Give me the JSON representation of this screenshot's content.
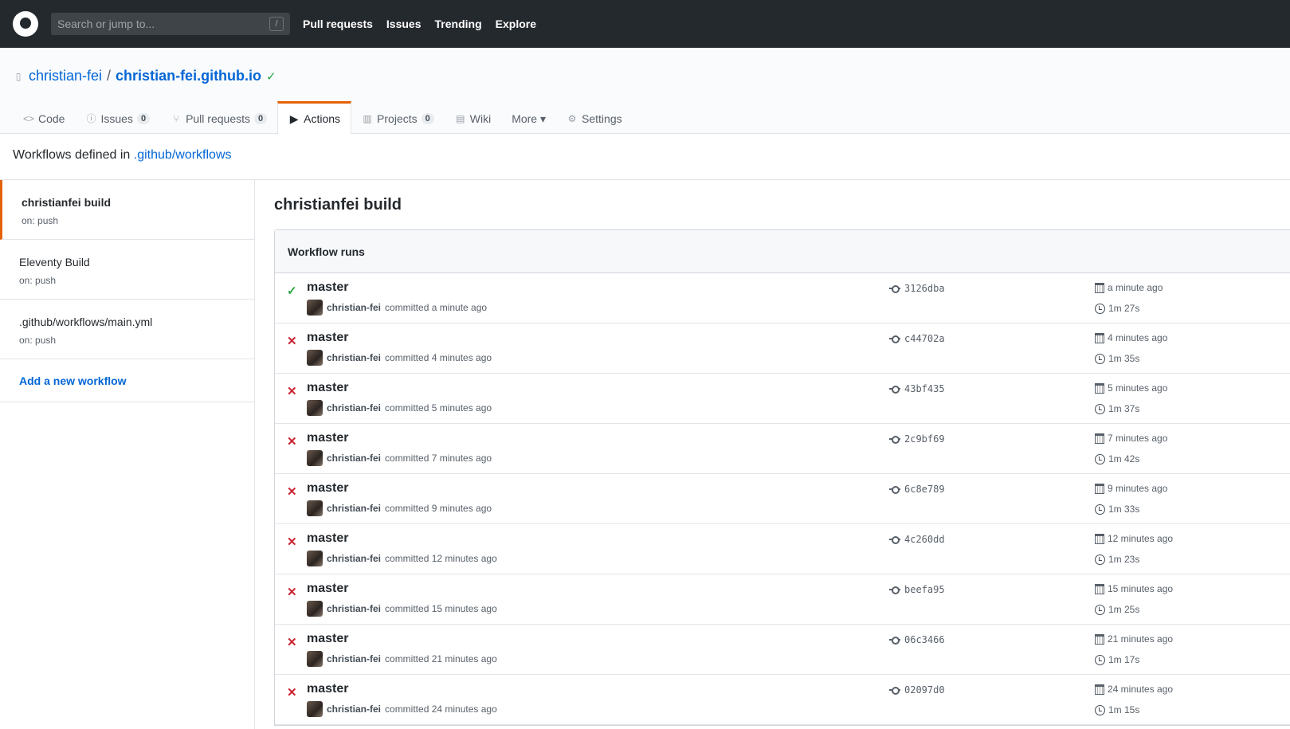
{
  "header": {
    "search_placeholder": "Search or jump to...",
    "search_shortcut": "/",
    "nav": [
      "Pull requests",
      "Issues",
      "Trending",
      "Explore"
    ]
  },
  "repo": {
    "owner": "christian-fei",
    "separator": "/",
    "name": "christian-fei.github.io",
    "status": "✓"
  },
  "tabs": [
    {
      "label": "Code",
      "icon": "code-icon"
    },
    {
      "label": "Issues",
      "count": "0",
      "icon": "issue-icon"
    },
    {
      "label": "Pull requests",
      "count": "0",
      "icon": "pull-request-icon"
    },
    {
      "label": "Actions",
      "icon": "play-icon"
    },
    {
      "label": "Projects",
      "count": "0",
      "icon": "project-icon"
    },
    {
      "label": "Wiki",
      "icon": "book-icon"
    },
    {
      "label": "More ▾"
    },
    {
      "label": "Settings",
      "icon": "gear-icon"
    }
  ],
  "workflows_line": {
    "prefix": "Workflows defined in",
    "link": ".github/workflows"
  },
  "sidebar": {
    "items": [
      {
        "title": "christianfei build",
        "trigger": "on: push"
      },
      {
        "title": "Eleventy Build",
        "trigger": "on: push"
      },
      {
        "title": ".github/workflows/main.yml",
        "trigger": "on: push"
      }
    ],
    "add_label": "Add a new workflow"
  },
  "main": {
    "title": "christianfei build",
    "box_title": "Workflow runs",
    "runs": [
      {
        "status": "success",
        "branch": "master",
        "user": "christian-fei",
        "committed": "committed a minute ago",
        "sha": "3126dba",
        "date": "a minute ago",
        "duration": "1m 27s"
      },
      {
        "status": "failure",
        "branch": "master",
        "user": "christian-fei",
        "committed": "committed 4 minutes ago",
        "sha": "c44702a",
        "date": "4 minutes ago",
        "duration": "1m 35s"
      },
      {
        "status": "failure",
        "branch": "master",
        "user": "christian-fei",
        "committed": "committed 5 minutes ago",
        "sha": "43bf435",
        "date": "5 minutes ago",
        "duration": "1m 37s"
      },
      {
        "status": "failure",
        "branch": "master",
        "user": "christian-fei",
        "committed": "committed 7 minutes ago",
        "sha": "2c9bf69",
        "date": "7 minutes ago",
        "duration": "1m 42s"
      },
      {
        "status": "failure",
        "branch": "master",
        "user": "christian-fei",
        "committed": "committed 9 minutes ago",
        "sha": "6c8e789",
        "date": "9 minutes ago",
        "duration": "1m 33s"
      },
      {
        "status": "failure",
        "branch": "master",
        "user": "christian-fei",
        "committed": "committed 12 minutes ago",
        "sha": "4c260dd",
        "date": "12 minutes ago",
        "duration": "1m 23s"
      },
      {
        "status": "failure",
        "branch": "master",
        "user": "christian-fei",
        "committed": "committed 15 minutes ago",
        "sha": "beefa95",
        "date": "15 minutes ago",
        "duration": "1m 25s"
      },
      {
        "status": "failure",
        "branch": "master",
        "user": "christian-fei",
        "committed": "committed 21 minutes ago",
        "sha": "06c3466",
        "date": "21 minutes ago",
        "duration": "1m 17s"
      },
      {
        "status": "failure",
        "branch": "master",
        "user": "christian-fei",
        "committed": "committed 24 minutes ago",
        "sha": "02097d0",
        "date": "24 minutes ago",
        "duration": "1m 15s"
      }
    ]
  }
}
